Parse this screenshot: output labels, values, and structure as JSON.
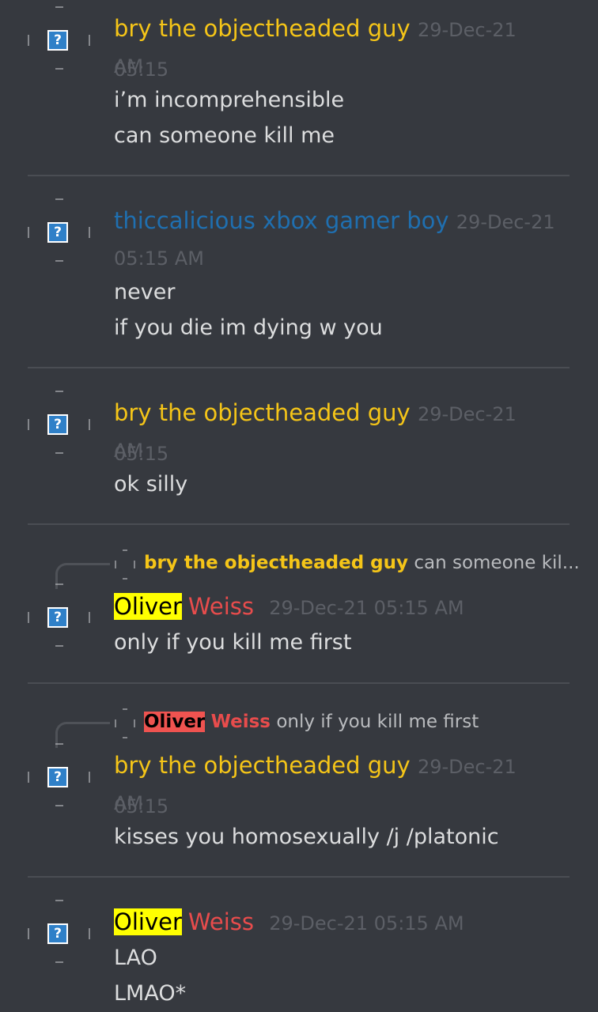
{
  "messages": [
    {
      "author": "bry the objectheaded guy",
      "timestamp_a": "29-Dec-21 05:15",
      "timestamp_b": "AM",
      "lines": [
        "i’m incomprehensible",
        "can someone kill me"
      ]
    },
    {
      "author": "thiccalicious xbox gamer boy",
      "timestamp_a": "29-Dec-21",
      "timestamp_b": "05:15 AM",
      "lines": [
        "never",
        "if you die im dying w you"
      ]
    },
    {
      "author": "bry the objectheaded guy",
      "timestamp_a": "29-Dec-21 05:15",
      "timestamp_b": "AM",
      "lines": [
        "ok silly"
      ]
    },
    {
      "reply_author": "bry the objectheaded guy",
      "reply_preview": "can someone kil...",
      "author_first": "Oliver",
      "author_last": "Weiss",
      "timestamp": "29-Dec-21 05:15 AM",
      "lines": [
        "only if you kill me first"
      ]
    },
    {
      "reply_author_first": "Oliver",
      "reply_author_last": "Weiss",
      "reply_preview": "only if you kill me first",
      "author": "bry the objectheaded guy",
      "timestamp_a": "29-Dec-21 05:15",
      "timestamp_b": "AM",
      "lines": [
        "kisses you homosexually /j /platonic"
      ]
    },
    {
      "author_first": "Oliver",
      "author_last": "Weiss",
      "timestamp": "29-Dec-21 05:15 AM",
      "lines": [
        "LAO",
        "LMAO*"
      ]
    }
  ],
  "colors": {
    "background": "#36393f",
    "bry": "#f5c518",
    "thicc": "#1f6fb0",
    "oliver": "#e84c4c"
  },
  "icons": {
    "avatar": "question-mark-icon"
  }
}
